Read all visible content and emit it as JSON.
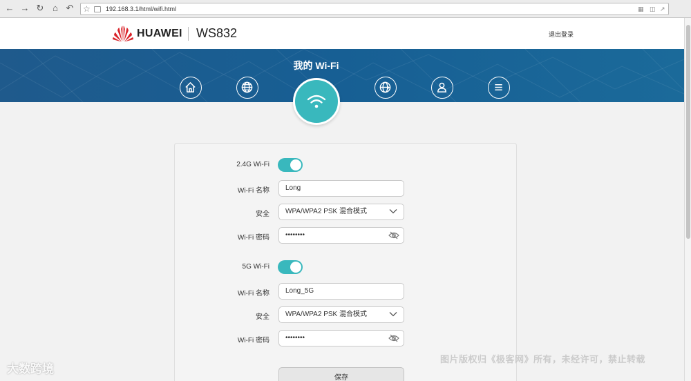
{
  "browser": {
    "url": "192.168.3.1/html/wifi.html"
  },
  "header": {
    "brand": "HUAWEI",
    "model": "WS832",
    "logout": "退出登录"
  },
  "banner": {
    "title": "我的 Wi-Fi",
    "nav_icons": [
      "home-icon",
      "internet-globe-icon",
      "wifi-icon",
      "globe-settings-icon",
      "user-icon",
      "menu-icon"
    ],
    "active": "wifi-icon"
  },
  "wifi24": {
    "toggle_label": "2.4G Wi-Fi",
    "enabled": true,
    "name_label": "Wi-Fi 名称",
    "name_value": "Long",
    "security_label": "安全",
    "security_value": "WPA/WPA2 PSK 混合模式",
    "password_label": "Wi-Fi 密码",
    "password_value": "••••••••"
  },
  "wifi5": {
    "toggle_label": "5G Wi-Fi",
    "enabled": true,
    "name_label": "Wi-Fi 名称",
    "name_value": "Long_5G",
    "security_label": "安全",
    "security_value": "WPA/WPA2 PSK 混合模式",
    "password_label": "Wi-Fi 密码",
    "password_value": "••••••••"
  },
  "save_label": "保存",
  "watermarks": {
    "left": "大数跨境",
    "right": "图片版权归《极客网》所有，未经许可，禁止转载"
  },
  "colors": {
    "accent": "#39b8bd",
    "banner": "#1a5f92"
  }
}
